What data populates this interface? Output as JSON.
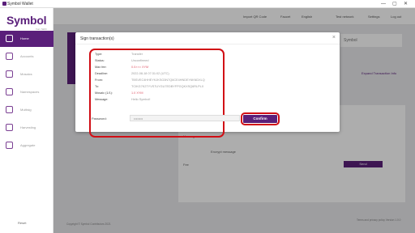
{
  "window": {
    "title": "Symbol Wallet",
    "controls": [
      "—",
      "▢",
      "✕"
    ]
  },
  "logo": {
    "name": "Symbol",
    "sub": "from NEM"
  },
  "sidebar": {
    "items": [
      {
        "label": "Home",
        "icon": "home-icon",
        "active": true
      },
      {
        "label": "Accounts",
        "icon": "accounts-icon",
        "active": false
      },
      {
        "label": "Mosaics",
        "icon": "mosaics-icon",
        "active": false
      },
      {
        "label": "Namespaces",
        "icon": "namespaces-icon",
        "active": false
      },
      {
        "label": "Multisig",
        "icon": "multisig-icon",
        "active": false
      },
      {
        "label": "Harvesting",
        "icon": "harvesting-icon",
        "active": false
      },
      {
        "label": "Aggregate",
        "icon": "aggregate-icon",
        "active": false
      }
    ],
    "reset": "Reset"
  },
  "topbar": {
    "items": [
      "Import QR Code",
      "Faucet",
      "English",
      "Test network",
      "Settings",
      "Log out"
    ]
  },
  "background": {
    "right_label": "Symbol",
    "fields": [
      "Message",
      "Encrypt message",
      "Fee",
      "Send"
    ],
    "footer": "Copyright © Symbol Contributors 2021",
    "footer_right": "Terms and privacy policy   Version 1.0.0",
    "link": "Expand Transaction Info"
  },
  "modal": {
    "title": "Sign transaction(s)",
    "rows": [
      {
        "label": "Type:",
        "value": "Transfer",
        "highlight": false
      },
      {
        "label": "Status:",
        "value": "Unconfirmed",
        "highlight": false
      },
      {
        "label": "Max fee:",
        "value": "0.0××× XYM",
        "highlight": true
      },
      {
        "label": "Deadline:",
        "value": "2022-08-18 07:31:02 (UTC)",
        "highlight": false
      },
      {
        "label": "From:",
        "value": "TBSVEC4HHEYKJKSG3N7Q6CE4HNDEY6KNDXLQ",
        "highlight": false
      },
      {
        "label": "To:",
        "value": "TCIKG7K2TYVS7UYGU7EDBYFPGQKXSQ6RLPLX",
        "highlight": false
      },
      {
        "label": "Mosaic (1/1):",
        "value": "1.0 XYM",
        "highlight": true
      },
      {
        "label": "Message:",
        "value": "Hello Symbol!",
        "highlight": false
      }
    ],
    "password_label": "Password:",
    "password_value": "••••••••",
    "confirm_label": "Confirm",
    "close": "×"
  }
}
